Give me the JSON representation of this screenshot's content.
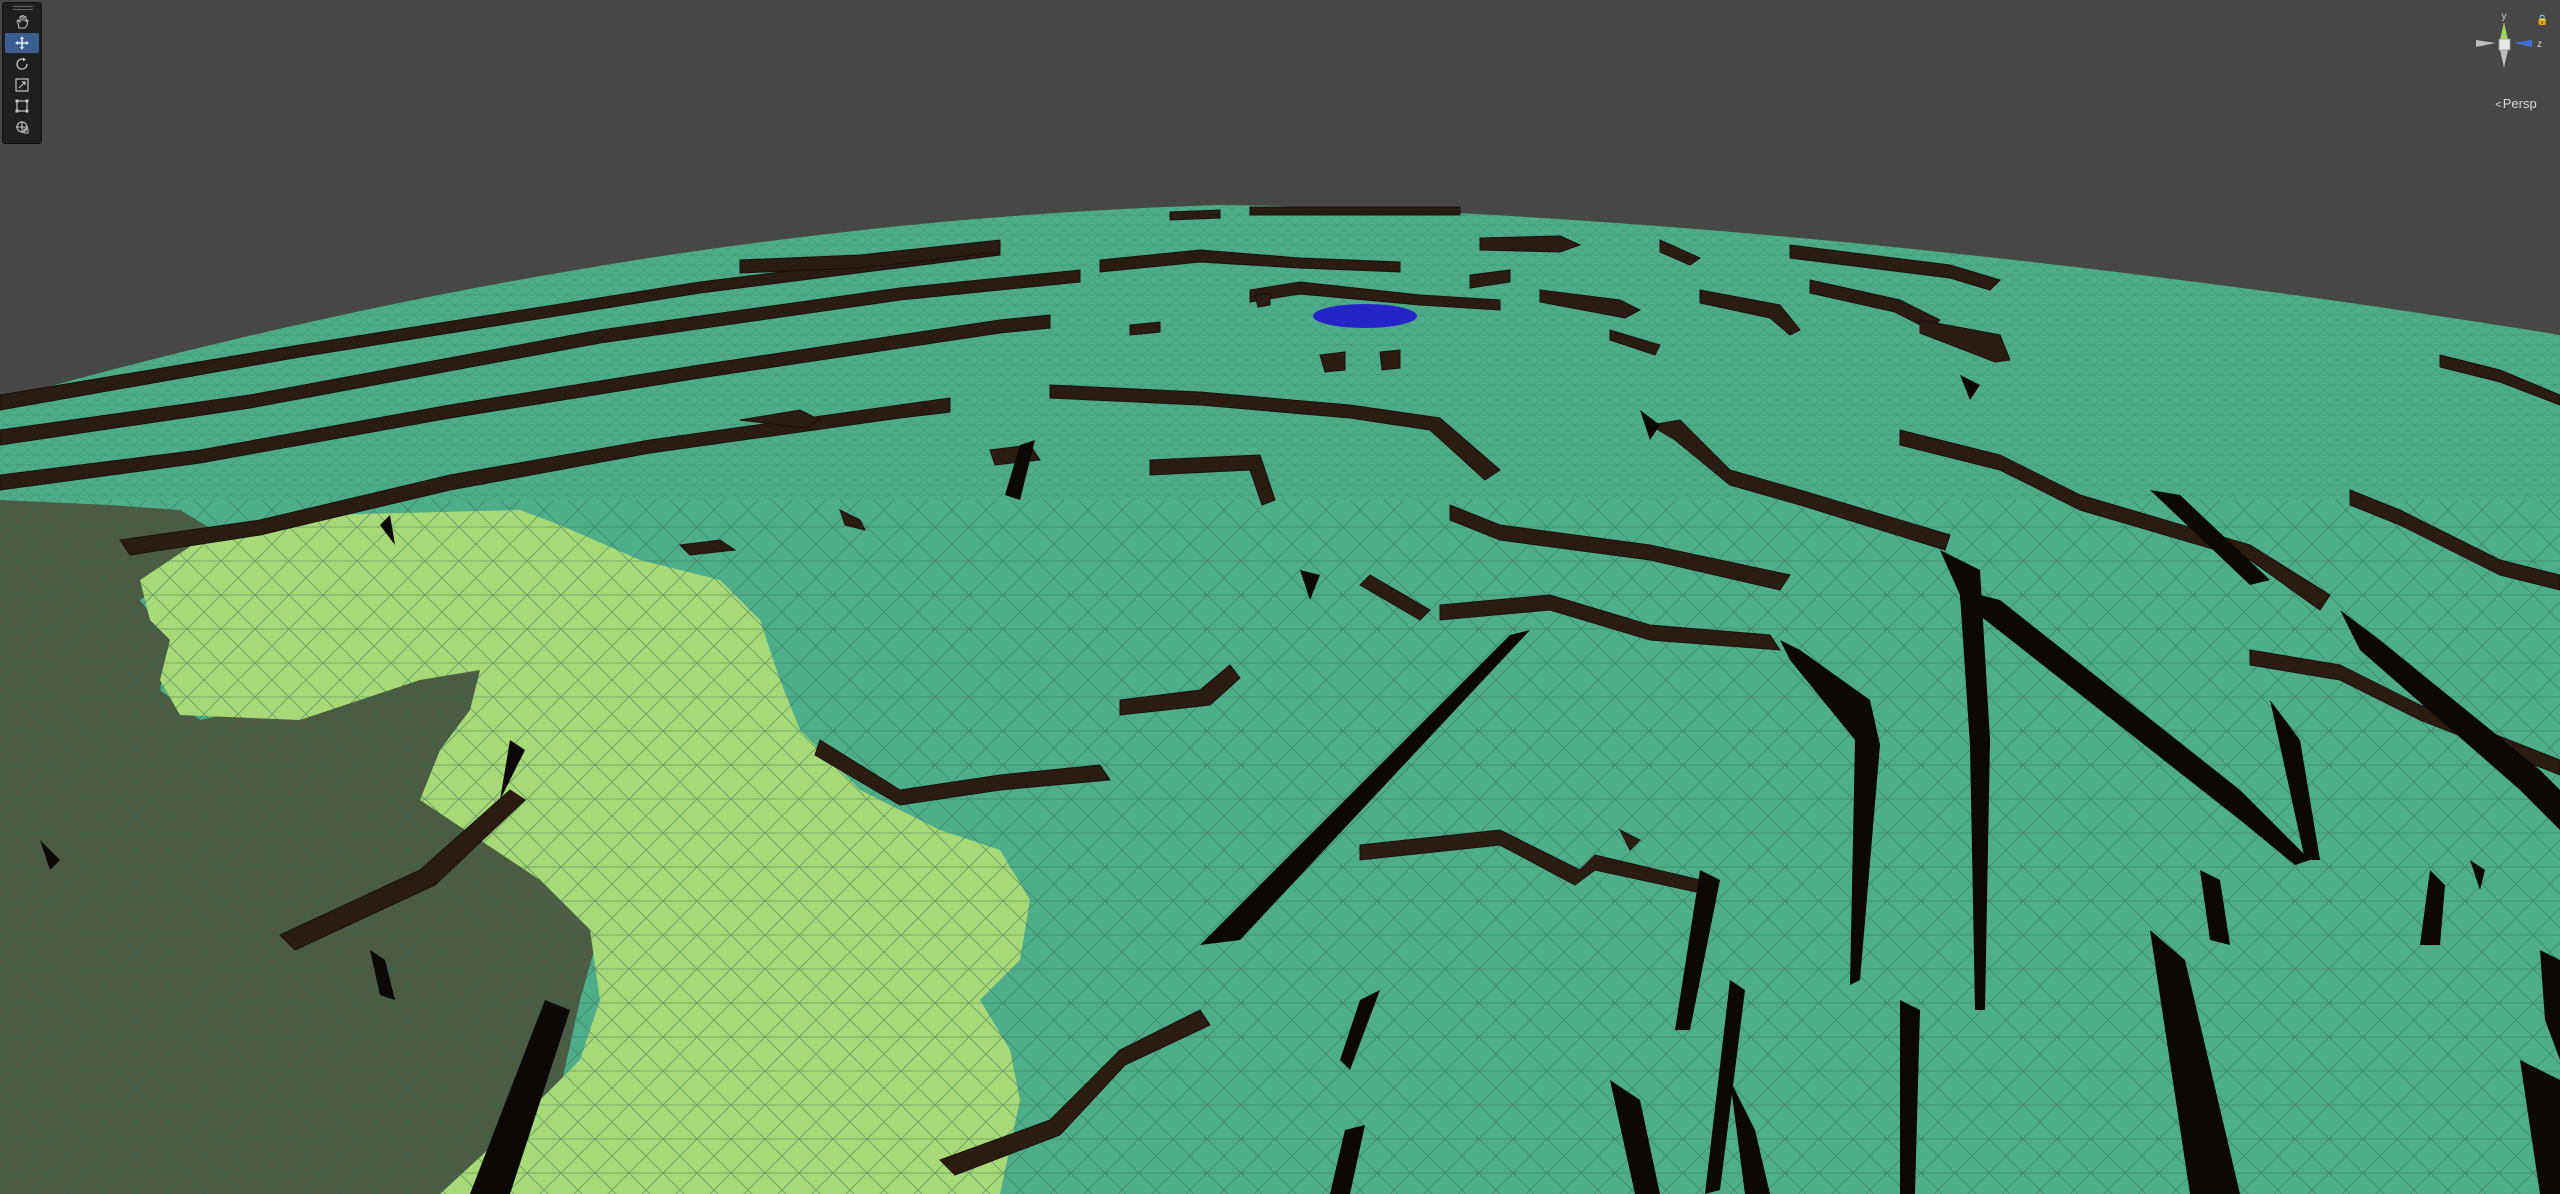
{
  "scene": {
    "sky_color": "#474747",
    "terrain_colors": {
      "grass": "#4fae8a",
      "light_grass": "#a8d977",
      "dark_grass": "#4b5c42",
      "cliff": "#2b1c12",
      "shadow": "#0b0806",
      "water": "#2424c8",
      "wire": "#2d5c4a"
    }
  },
  "toolbar": {
    "tools": [
      {
        "name": "hand-tool",
        "icon": "hand-icon",
        "active": false
      },
      {
        "name": "move-tool",
        "icon": "move-icon",
        "active": true
      },
      {
        "name": "rotate-tool",
        "icon": "rotate-icon",
        "active": false
      },
      {
        "name": "scale-tool",
        "icon": "scale-icon",
        "active": false
      },
      {
        "name": "rect-tool",
        "icon": "rect-icon",
        "active": false
      },
      {
        "name": "transform-tool",
        "icon": "transform-icon",
        "active": false
      }
    ]
  },
  "gizmo": {
    "y_label": "y",
    "z_label": "z",
    "projection_label": "Persp",
    "y_color": "#a4d65e",
    "z_color": "#3f6fd8"
  }
}
